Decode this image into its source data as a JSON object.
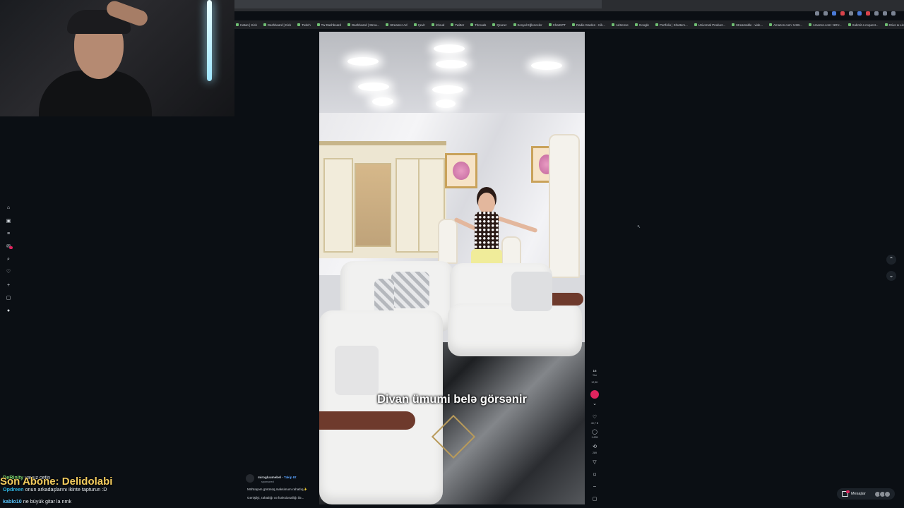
{
  "browser": {
    "bookmarks": [
      "Instan | Kick",
      "Dashboard | Kick",
      "Twitch",
      "Tw Dashboard",
      "Dashboard | Strea...",
      "Streamer Ad",
      "Çevir",
      "iCloud",
      "Twitter",
      "Threads",
      "Qcuruz",
      "Sosyal Eğlenceler",
      "ChatGPT",
      "Radio Garden - Kik...",
      "AdSense",
      "Google",
      "Portfolio | Shutters...",
      "Universal Product...",
      "Streamable - vide...",
      "Amazon.com: USB...",
      "Amazon.com: NOV...",
      "Submit a request...",
      "Drive & Listen",
      "Tüm Yer İşaretleri"
    ]
  },
  "video": {
    "caption": "Divan ümumi belə görsənir"
  },
  "rail": {
    "count_top": "16",
    "count_top_sub": "Yüz",
    "follow_sub": "12,5K",
    "likes": "40,7 B",
    "comments": "1.635",
    "reposts": "289"
  },
  "post": {
    "author": "mirogluumebel",
    "follow_label": "Takip Et",
    "sub": "sponsored",
    "line1": "Möhtəşəm görünüş,maksimum rahatlıq✨",
    "line2": "Genişliyi, rahatlığı və funksionallığı ilə..."
  },
  "messages": {
    "label": "Mesajlar"
  },
  "chat": {
    "user1": "DeRinity",
    "msg1": "yavuz çetin",
    "user2": "Opdreen",
    "msg2": "onun arkadaşlarını ikinte tapturun :D",
    "user3": "kablo10",
    "msg3": "ne büyük gitar la nmk"
  },
  "overlay": {
    "text": "Son Abone: Delidolabi"
  }
}
